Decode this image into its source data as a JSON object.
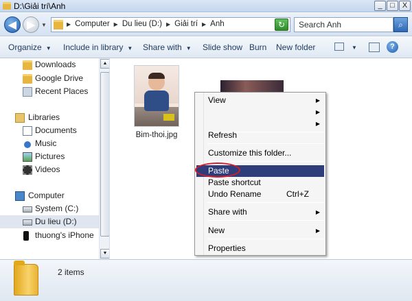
{
  "window": {
    "title": "D:\\Giải trí\\Anh",
    "controls": [
      "_",
      "□",
      "X"
    ]
  },
  "address": {
    "breadcrumbs": [
      "Computer",
      "Du lieu (D:)",
      "Giải trí",
      "Anh"
    ],
    "search_placeholder": "Search Anh"
  },
  "toolbar": {
    "organize": "Organize",
    "include_in_library": "Include in library",
    "share_with": "Share with",
    "slide_show": "Slide show",
    "burn": "Burn",
    "new_folder": "New folder"
  },
  "nav": {
    "favorites": [
      "Downloads",
      "Google Drive",
      "Recent Places"
    ],
    "libraries_label": "Libraries",
    "libraries": [
      "Documents",
      "Music",
      "Pictures",
      "Videos"
    ],
    "computer_label": "Computer",
    "drives": [
      "System (C:)",
      "Du lieu (D:)",
      "thuong's iPhone"
    ],
    "selected": "Du lieu (D:)"
  },
  "content": {
    "files": [
      "Bim-thoi.jpg"
    ]
  },
  "context_menu": {
    "view": "View",
    "refresh": "Refresh",
    "customize": "Customize this folder...",
    "paste": "Paste",
    "paste_shortcut": "Paste shortcut",
    "undo_rename": "Undo Rename",
    "undo_shortcut": "Ctrl+Z",
    "share_with": "Share with",
    "new": "New",
    "properties": "Properties",
    "highlighted": "Paste"
  },
  "status": {
    "item_count": "2 items"
  },
  "colors": {
    "menu_highlight": "#2f3d7a",
    "annotation_ring": "#d71c2c"
  }
}
